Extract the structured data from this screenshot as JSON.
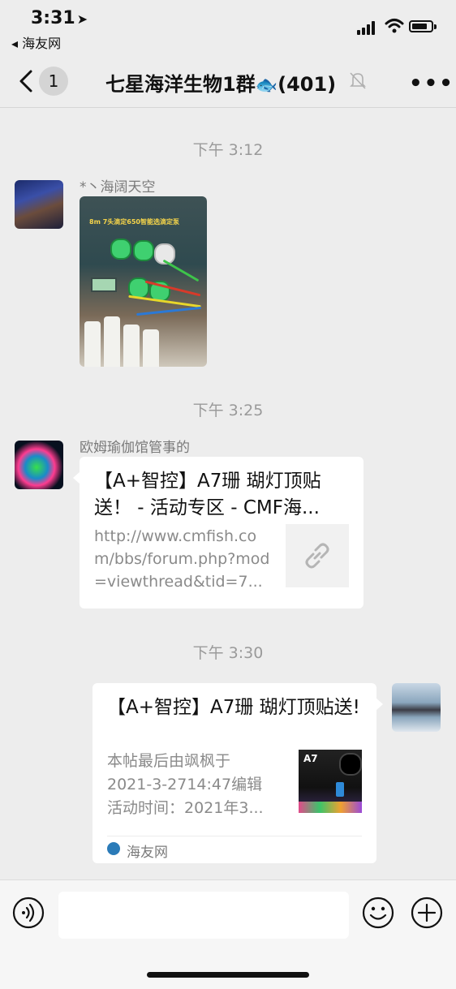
{
  "status_bar": {
    "time": "3:31",
    "back_app": "海友网",
    "battery_level": 0.8
  },
  "nav": {
    "unread_count": "1",
    "title": "七星海洋生物1群",
    "title_emoji": "🐟",
    "member_count": "(401)"
  },
  "messages": [
    {
      "timestamp": "下午 3:12",
      "sender": "*丶海阔天空",
      "type": "image",
      "image_caption": "8m 7头滴定650智能选滴定泵"
    },
    {
      "timestamp": "下午 3:25",
      "sender": "欧姆瑜伽馆管事的",
      "type": "link",
      "title": "【A+智控】A7珊 瑚灯顶贴送！ - 活动专区 - CMF海...",
      "description": "http://www.cmfish.com/bbs/forum.php?mod=viewthread&tid=7..."
    },
    {
      "timestamp": "下午 3:30",
      "sender": "",
      "type": "link-self",
      "title": "【A+智控】A7珊 瑚灯顶贴送!",
      "description_lines": [
        "本帖最后由飒枫于",
        "2021-3-2714:47编辑",
        "活动时间：2021年3..."
      ],
      "thumb_text": "A7",
      "source": "海友网"
    }
  ],
  "icons": {
    "back": "chevron-left-icon",
    "mute": "bell-slash-icon",
    "more": "ellipsis-icon",
    "voice": "voice-icon",
    "emoji": "emoji-icon",
    "plus": "plus-icon",
    "link": "link-icon"
  }
}
